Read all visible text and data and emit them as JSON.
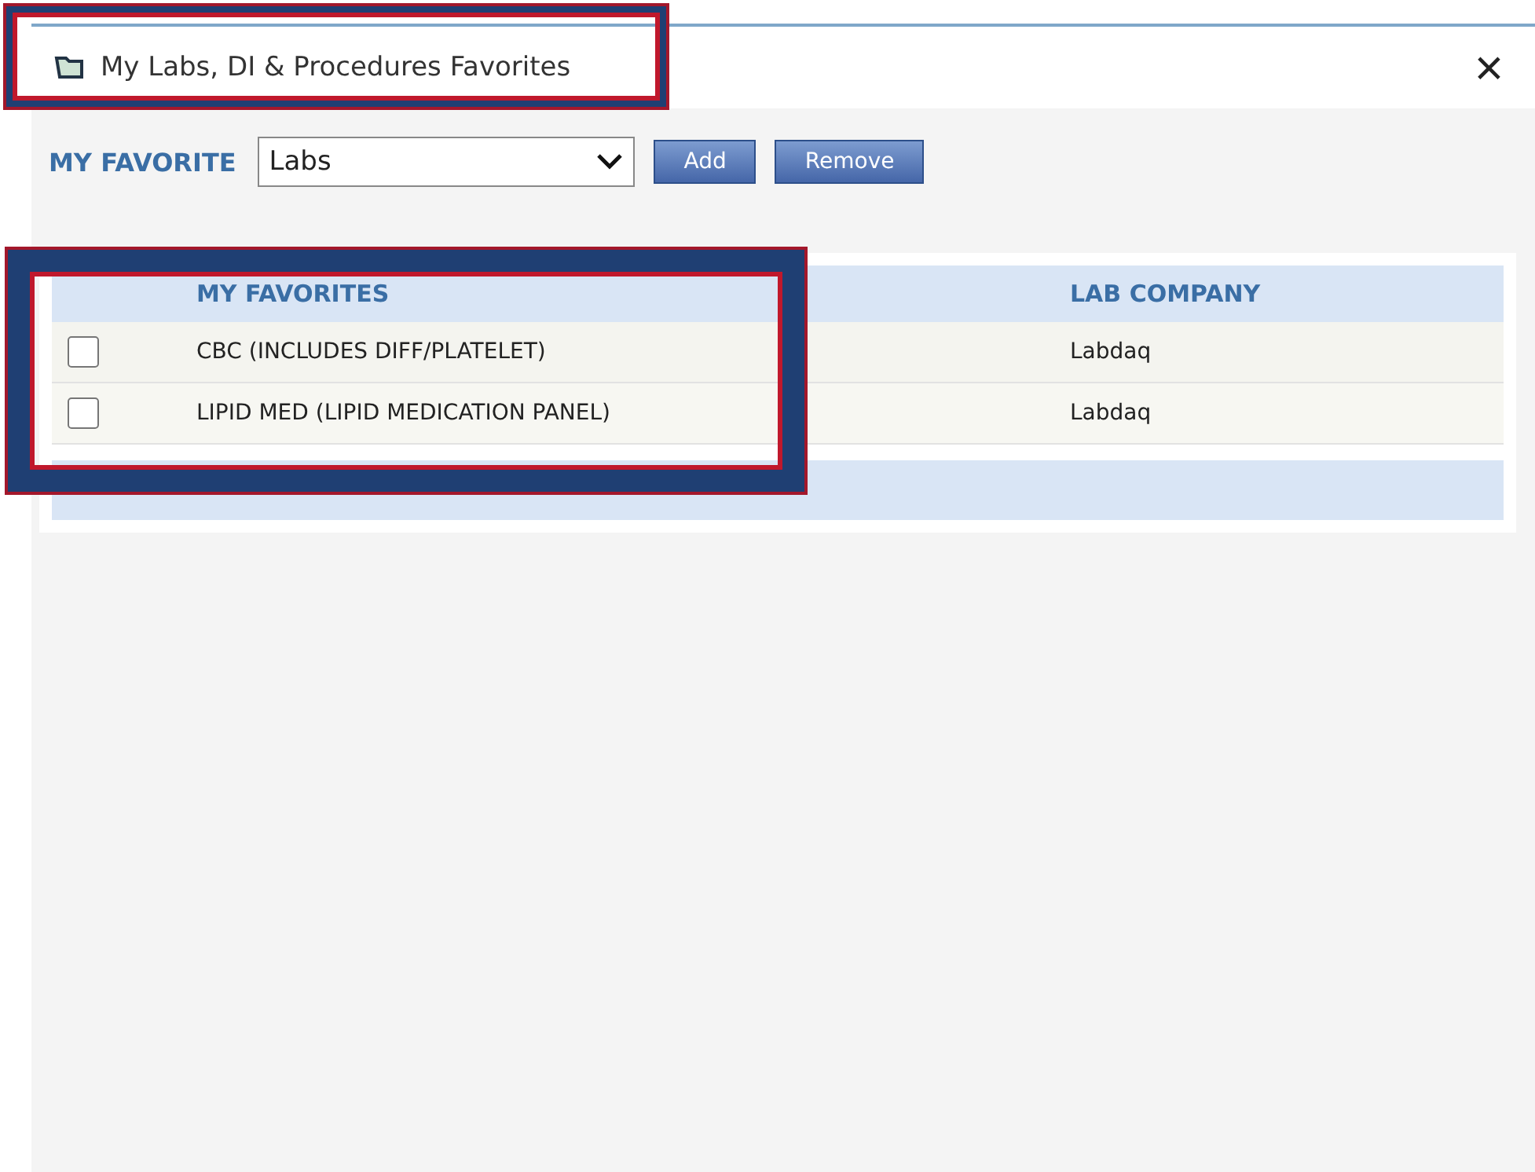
{
  "window": {
    "title": "My Labs, DI & Procedures Favorites",
    "close": "×"
  },
  "toolbar": {
    "label": "MY FAVORITE",
    "dropdown": {
      "value": "Labs"
    },
    "buttons": [
      "Add",
      "Remove"
    ]
  },
  "table": {
    "columns": [
      "MY FAVORITES",
      "LAB COMPANY"
    ],
    "rows": [
      {
        "name": "CBC (INCLUDES DIFF/PLATELET)",
        "company": "Labdaq",
        "checked": false
      },
      {
        "name": "LIPID MED (LIPID MEDICATION PANEL)",
        "company": "Labdaq",
        "checked": false
      }
    ]
  }
}
